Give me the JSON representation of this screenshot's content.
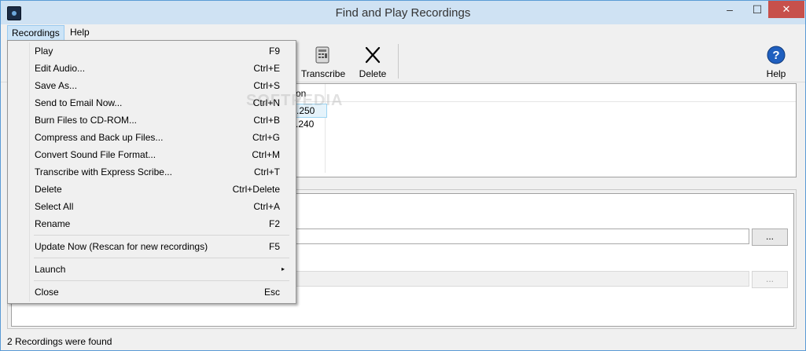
{
  "window": {
    "title": "Find and Play Recordings",
    "min_glyph": "–",
    "max_glyph": "☐",
    "close_glyph": "✕"
  },
  "menubar": {
    "recordings": "Recordings",
    "help": "Help"
  },
  "toolbar": {
    "transcribe": "Transcribe",
    "delete": "Delete",
    "help": "Help"
  },
  "list": {
    "header_fragment": "on",
    "values": [
      ".250",
      ".240"
    ]
  },
  "browse_label": "...",
  "status": "2 Recordings were found",
  "watermark": "SOFTPEDIA",
  "dropdown": {
    "play": {
      "label": "Play",
      "shortcut": "F9"
    },
    "edit_audio": {
      "label": "Edit Audio...",
      "shortcut": "Ctrl+E"
    },
    "save_as": {
      "label": "Save As...",
      "shortcut": "Ctrl+S"
    },
    "send_email": {
      "label": "Send to Email Now...",
      "shortcut": "Ctrl+N"
    },
    "burn": {
      "label": "Burn Files to CD-ROM...",
      "shortcut": "Ctrl+B"
    },
    "compress": {
      "label": "Compress and Back up Files...",
      "shortcut": "Ctrl+G"
    },
    "convert": {
      "label": "Convert Sound File Format...",
      "shortcut": "Ctrl+M"
    },
    "transcribe": {
      "label": "Transcribe with Express Scribe...",
      "shortcut": "Ctrl+T"
    },
    "delete": {
      "label": "Delete",
      "shortcut": "Ctrl+Delete"
    },
    "select_all": {
      "label": "Select All",
      "shortcut": "Ctrl+A"
    },
    "rename": {
      "label": "Rename",
      "shortcut": "F2"
    },
    "update": {
      "label": "Update Now (Rescan for new recordings)",
      "shortcut": "F5"
    },
    "launch": {
      "label": "Launch",
      "arrow": "▸"
    },
    "close": {
      "label": "Close",
      "shortcut": "Esc"
    }
  },
  "colors": {
    "title_bg": "#cfe2f3",
    "close_bg": "#c7504b",
    "menu_active_bg": "#cce4f7",
    "help_icon": "#1f5fbf"
  },
  "icons": [
    "app-icon",
    "transcribe-icon",
    "delete-x-icon",
    "help-question-icon",
    "submenu-arrow-icon"
  ]
}
